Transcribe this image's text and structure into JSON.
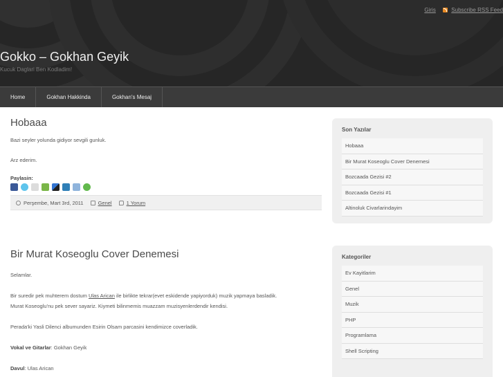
{
  "header": {
    "login_label": "Giris",
    "rss_label": "Subscribe RSS Feed",
    "site_title": "Gokko – Gokhan Geyik",
    "site_description": "Kucuk Daglari Ben Kodladim!"
  },
  "nav": {
    "items": [
      {
        "label": "Home"
      },
      {
        "label": "Gokhan Hakkinda"
      },
      {
        "label": "Gokhan's Mesaj"
      }
    ]
  },
  "posts": [
    {
      "title": "Hobaaa",
      "paragraphs": [
        "Bazi seyler yolunda gidiyor sevgili gunluk.",
        "Arz ederim."
      ],
      "share_label": "Paylasin:",
      "share_icons": [
        "facebook-icon",
        "twitter-icon",
        "digg-icon",
        "google-icon",
        "delicious-icon",
        "linkedin-icon",
        "technorati-icon",
        "stumbleupon-icon"
      ],
      "date": "Perşembe, Mart 3rd, 2011",
      "category": "Genel",
      "comments": "1 Yorum"
    },
    {
      "title": "Bir Murat Koseoglu Cover Denemesi",
      "p1": "Selamlar.",
      "p2_before": "Bir suredir pek muhterem dostum ",
      "p2_link": "Ulas Arican",
      "p2_after": " ile birlikte tekrar(evet eskidende yapiyorduk) muzik yapmaya basladik.",
      "p2_line2": "Murat Koseoglu'nu pek sever sayariz. Kiymeti bilinmemis muazzam muzisyenlerdendir kendisi.",
      "p3": "Perada'ki Yasli Dilenci albumunden Esirin Olsam parcasini kendimizce coverladik.",
      "vocal_label": "Vokal ve Gitarlar",
      "vocal_value": ": Gokhan Geyik",
      "drum_label": "Davul",
      "drum_value": ": Ulas Arican"
    }
  ],
  "sidebar": {
    "recent": {
      "title": "Son Yazılar",
      "items": [
        "Hobaaa",
        "Bir Murat Koseoglu Cover Denemesi",
        "Bozcaada Gezisi #2",
        "Bozcaada Gezisi #1",
        "Altinoluk Civarlarindayim"
      ]
    },
    "categories": {
      "title": "Kategoriler",
      "items": [
        "Ev Kayitlarim",
        "Genel",
        "Muzik",
        "PHP",
        "Programlama",
        "Shell Scripting"
      ]
    }
  },
  "colors": {
    "header_bg": "#2a2a2a",
    "nav_bg": "#3b3b3b",
    "rss": "#e98a23",
    "widget_bg": "#efefef"
  }
}
